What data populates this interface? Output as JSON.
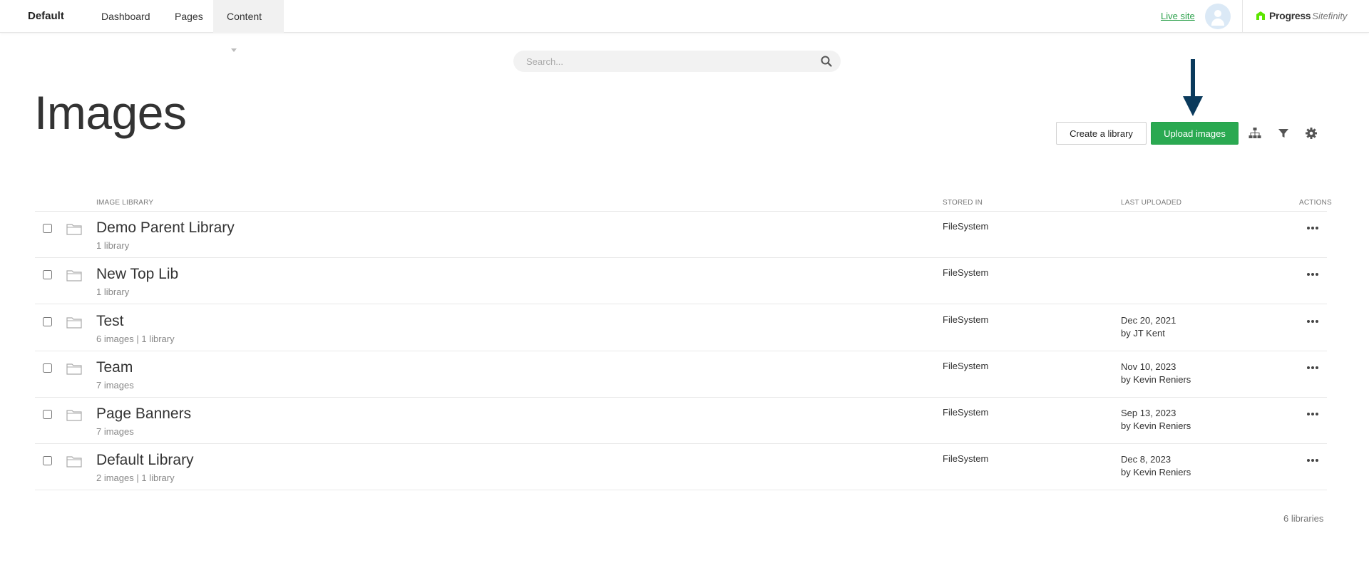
{
  "topbar": {
    "site_name": "Default",
    "nav": [
      {
        "label": "Dashboard"
      },
      {
        "label": "Pages"
      },
      {
        "label": "Content"
      }
    ],
    "live_site": "Live site",
    "logo_text": "Progress",
    "logo_sub": "Sitefinity"
  },
  "search": {
    "placeholder": "Search..."
  },
  "page": {
    "title": "Images"
  },
  "toolbar": {
    "create_label": "Create a library",
    "upload_label": "Upload images",
    "upload_color": "#2aa951"
  },
  "table": {
    "headers": {
      "library": "Image library",
      "stored": "Stored in",
      "uploaded": "Last uploaded",
      "actions": "Actions"
    },
    "rows": [
      {
        "name": "Demo Parent Library",
        "meta": "1 library",
        "stored": "FileSystem",
        "date": "",
        "by": ""
      },
      {
        "name": "New Top Lib",
        "meta": "1 library",
        "stored": "FileSystem",
        "date": "",
        "by": ""
      },
      {
        "name": "Test",
        "meta": "6 images | 1 library",
        "stored": "FileSystem",
        "date": "Dec 20, 2021",
        "by": "by JT Kent"
      },
      {
        "name": "Team",
        "meta": "7 images",
        "stored": "FileSystem",
        "date": "Nov 10, 2023",
        "by": "by Kevin Reniers"
      },
      {
        "name": "Page Banners",
        "meta": "7 images",
        "stored": "FileSystem",
        "date": "Sep 13, 2023",
        "by": "by Kevin Reniers"
      },
      {
        "name": "Default Library",
        "meta": "2 images | 1 library",
        "stored": "FileSystem",
        "date": "Dec 8, 2023",
        "by": "by Kevin Reniers"
      }
    ],
    "footer_count": "6 libraries"
  }
}
